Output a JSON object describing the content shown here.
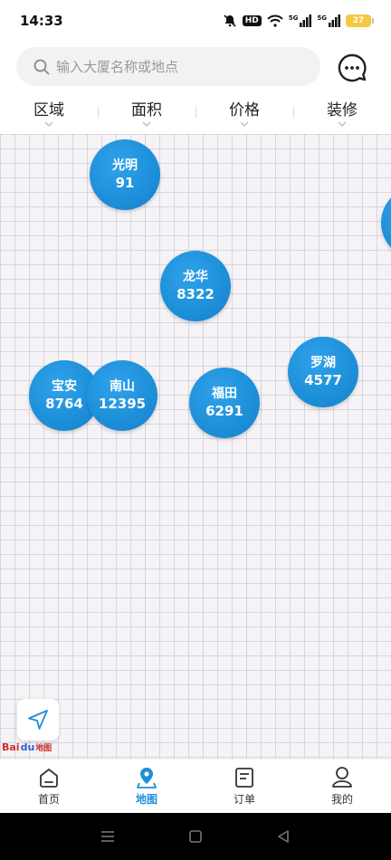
{
  "status": {
    "time": "14:33",
    "hd_label": "HD",
    "sig1_label": "5G",
    "sig2_label": "5G",
    "battery": "27"
  },
  "search": {
    "placeholder": "输入大厦名称或地点"
  },
  "filters": [
    {
      "label": "区域"
    },
    {
      "label": "面积"
    },
    {
      "label": "价格"
    },
    {
      "label": "装修"
    }
  ],
  "map": {
    "districts": [
      {
        "name": "光明",
        "count": "91"
      },
      {
        "name": "龙华",
        "count": "8322"
      },
      {
        "name": "宝安",
        "count": "8764"
      },
      {
        "name": "南山",
        "count": "12395"
      },
      {
        "name": "福田",
        "count": "6291"
      },
      {
        "name": "罗湖",
        "count": "4577"
      }
    ],
    "attribution": {
      "brand": "Bai",
      "paw": "du",
      "suffix": "地图"
    }
  },
  "tabbar": [
    {
      "label": "首页",
      "icon": "home-icon"
    },
    {
      "label": "地图",
      "icon": "map-pin-icon",
      "active": true
    },
    {
      "label": "订单",
      "icon": "order-icon"
    },
    {
      "label": "我的",
      "icon": "user-icon"
    }
  ],
  "colors": {
    "accent": "#1d8fd9",
    "bubble": "#1d8fd9",
    "map_bg": "#f6f3f6"
  }
}
